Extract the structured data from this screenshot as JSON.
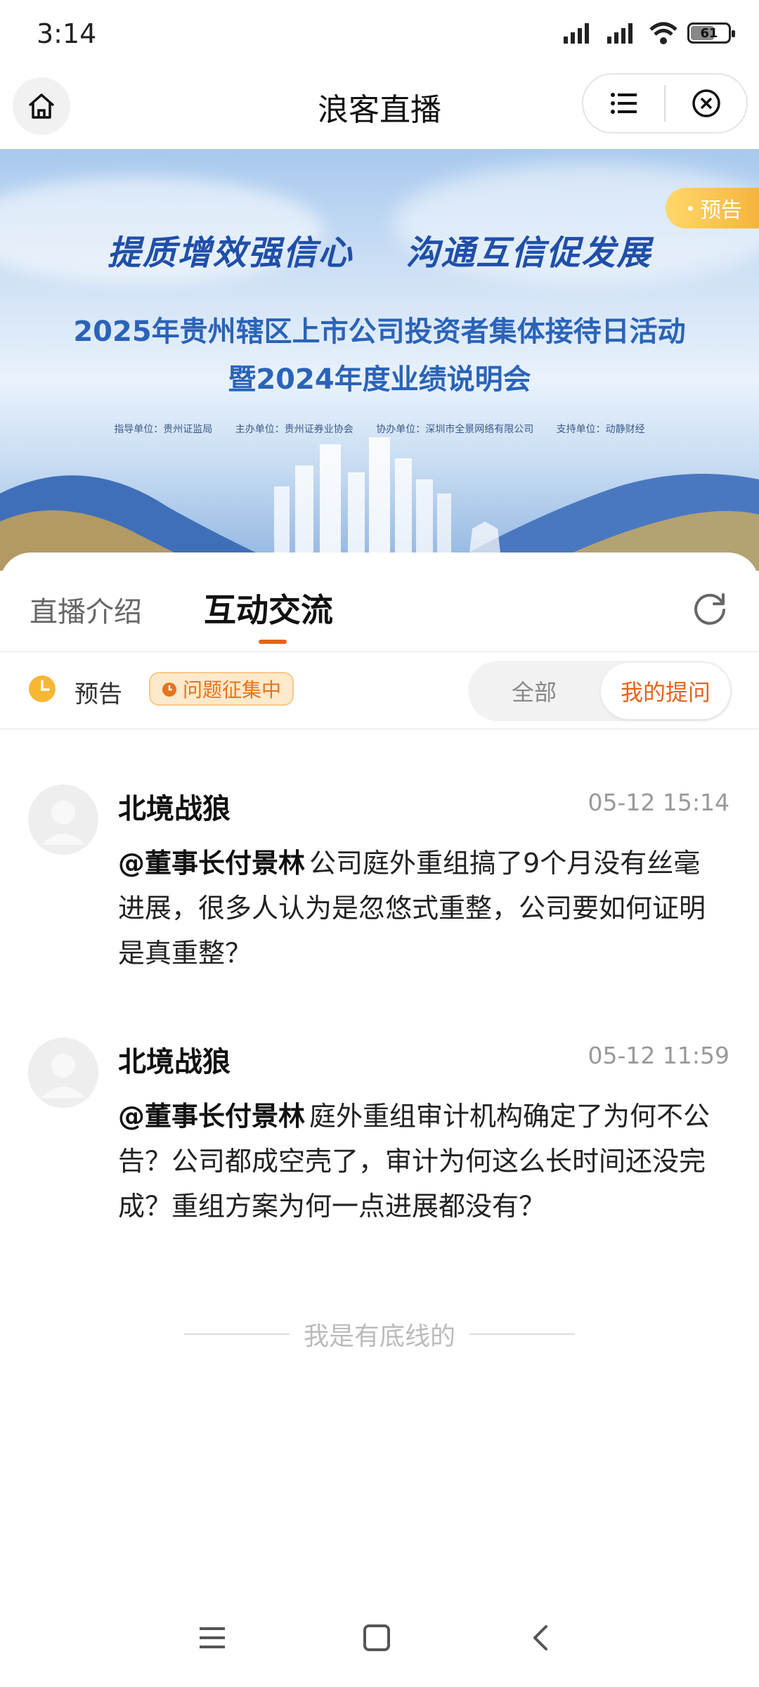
{
  "status_bar": {
    "time": "3:14",
    "battery": "61",
    "battery_level": 0.61
  },
  "nav": {
    "title": "浪客直播"
  },
  "banner": {
    "slogan_left": "提质增效强信心",
    "slogan_right": "沟通互信促发展",
    "title_line1": "2025年贵州辖区上市公司投资者集体接待日活动",
    "title_line2": "暨2024年度业绩说明会",
    "units": [
      "指导单位：贵州证监局",
      "主办单位：贵州证券业协会",
      "协办单位：深圳市全景网络有限公司",
      "支持单位：动静财经"
    ],
    "badge": "预告"
  },
  "tabs": {
    "intro": "直播介绍",
    "chat": "互动交流"
  },
  "filter": {
    "status": "预告",
    "collect": "问题征集中",
    "all": "全部",
    "mine": "我的提问"
  },
  "questions": [
    {
      "user": "北境战狼",
      "time": "05-12 15:14",
      "mention": "@董事长付景林",
      "text": "公司庭外重组搞了9个月没有丝毫进展，很多人认为是忽悠式重整，公司要如何证明是真重整？"
    },
    {
      "user": "北境战狼",
      "time": "05-12 11:59",
      "mention": "@董事长付景林",
      "text": "庭外重组审计机构确定了为何不公告？公司都成空壳了，审计为何这么长时间还没完成？重组方案为何一点进展都没有？"
    }
  ],
  "footer_baseline": "我是有底线的",
  "colors": {
    "accent": "#e8631a",
    "banner_blue": "#2a63b8",
    "badge_gold": "#f6b43c"
  }
}
